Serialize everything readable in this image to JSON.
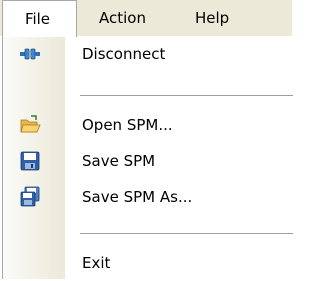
{
  "menubar": {
    "items": [
      {
        "label": "File"
      },
      {
        "label": "Action"
      },
      {
        "label": "Help"
      }
    ]
  },
  "file_menu": {
    "items": [
      {
        "label": "Disconnect",
        "icon": "disconnect-plug-icon"
      },
      {
        "label": "Open SPM...",
        "icon": "open-folder-icon"
      },
      {
        "label": "Save SPM",
        "icon": "save-disk-icon"
      },
      {
        "label": "Save SPM As...",
        "icon": "save-as-disks-icon"
      },
      {
        "label": "Exit",
        "icon": ""
      }
    ]
  },
  "colors": {
    "menubar_bg": "#ece9d8",
    "menu_bg": "#ffffff",
    "border": "#a8a8a8",
    "separator": "#a0a0a0"
  }
}
